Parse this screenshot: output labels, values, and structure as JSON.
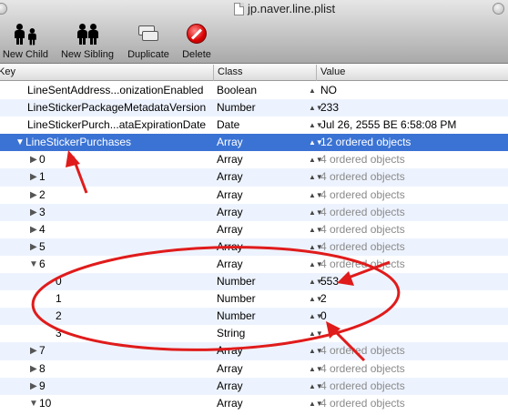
{
  "window": {
    "title": "jp.naver.line.plist"
  },
  "toolbar": {
    "new_child": "New Child",
    "new_sibling": "New Sibling",
    "duplicate": "Duplicate",
    "delete": "Delete"
  },
  "columns": {
    "key": "Key",
    "class": "Class",
    "value": "Value"
  },
  "rows": [
    {
      "key": "LineSentAddress...onizationEnabled",
      "class": "Boolean",
      "value": "NO"
    },
    {
      "key": "LineStickerPackageMetadataVersion",
      "class": "Number",
      "value": "233"
    },
    {
      "key": "LineStickerPurch...ataExpirationDate",
      "class": "Date",
      "value": "Jul 26, 2555 BE 6:58:08 PM"
    },
    {
      "key": "LineStickerPurchases",
      "class": "Array",
      "value": "12 ordered objects"
    },
    {
      "key": "0",
      "class": "Array",
      "value": "4 ordered objects"
    },
    {
      "key": "1",
      "class": "Array",
      "value": "4 ordered objects"
    },
    {
      "key": "2",
      "class": "Array",
      "value": "4 ordered objects"
    },
    {
      "key": "3",
      "class": "Array",
      "value": "4 ordered objects"
    },
    {
      "key": "4",
      "class": "Array",
      "value": "4 ordered objects"
    },
    {
      "key": "5",
      "class": "Array",
      "value": "4 ordered objects"
    },
    {
      "key": "6",
      "class": "Array",
      "value": "4 ordered objects"
    },
    {
      "key": "0",
      "class": "Number",
      "value": "553"
    },
    {
      "key": "1",
      "class": "Number",
      "value": "2"
    },
    {
      "key": "2",
      "class": "Number",
      "value": "0"
    },
    {
      "key": "3",
      "class": "String",
      "value": ""
    },
    {
      "key": "7",
      "class": "Array",
      "value": "4 ordered objects"
    },
    {
      "key": "8",
      "class": "Array",
      "value": "4 ordered objects"
    },
    {
      "key": "9",
      "class": "Array",
      "value": "4 ordered objects"
    },
    {
      "key": "10",
      "class": "Array",
      "value": "4 ordered objects"
    }
  ],
  "colors": {
    "selection": "#3b73d4",
    "annotation": "#e01b1b",
    "stripe": "#edf3fe"
  }
}
